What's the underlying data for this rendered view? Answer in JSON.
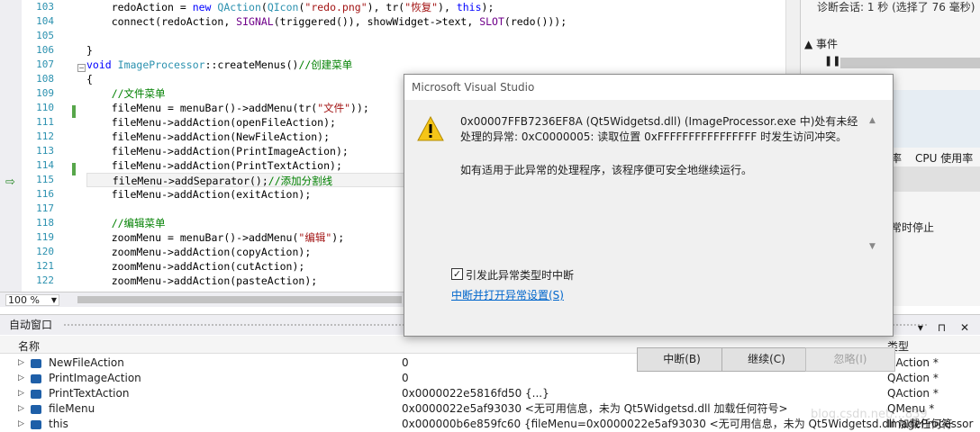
{
  "editor": {
    "line_numbers": [
      "103",
      "104",
      "105",
      "106",
      "107",
      "108",
      "109",
      "110",
      "111",
      "112",
      "113",
      "114",
      "115",
      "116",
      "117",
      "118",
      "119",
      "120",
      "121",
      "122"
    ],
    "zoom": "100 %"
  },
  "diagnostics": {
    "session": "诊断会话: 1 秒 (选择了 76 毫秒)",
    "events": "▲ 事件",
    "pause": "❚❚",
    "cpu_label": "率",
    "cpu_usage": "CPU 使用率",
    "stop_label": "常时停止"
  },
  "autos": {
    "title": "自动窗口",
    "col_name": "名称",
    "col_type": "类型",
    "rows": [
      {
        "name": "NewFileAction",
        "value": "0",
        "type": "QAction *"
      },
      {
        "name": "PrintImageAction",
        "value": "0",
        "type": "QAction *"
      },
      {
        "name": "PrintTextAction",
        "value": "0x0000022e5816fd50 {...}",
        "type": "QAction *"
      },
      {
        "name": "fileMenu",
        "value": "0x0000022e5af93030 <无可用信息，未为 Qt5Widgetsd.dll 加载任何符号>",
        "type": "QMenu *"
      },
      {
        "name": "this",
        "value": "0x000000b6e859fc60 {fileMenu=0x0000022e5af93030 <无可用信息，未为 Qt5Widgetsd.dll 加载任何符",
        "type": "ImageProcessor *"
      }
    ],
    "buttons": "▾ ⊓ ✕"
  },
  "dialog": {
    "title": "Microsoft Visual Studio",
    "message": "0x00007FFB7236EF8A (Qt5Widgetsd.dll) (ImageProcessor.exe 中)处有未经处理的异常: 0xC0000005: 读取位置 0xFFFFFFFFFFFFFFFF 时发生访问冲突。",
    "hint": "如有适用于此异常的处理程序，该程序便可安全地继续运行。",
    "checkbox_label": "引发此异常类型时中断",
    "link": "中断并打开异常设置(S)",
    "btn_break": "中断(B)",
    "btn_continue": "继续(C)",
    "btn_ignore": "忽略(I)"
  },
  "watermark": "blog.csdn.net/...839"
}
